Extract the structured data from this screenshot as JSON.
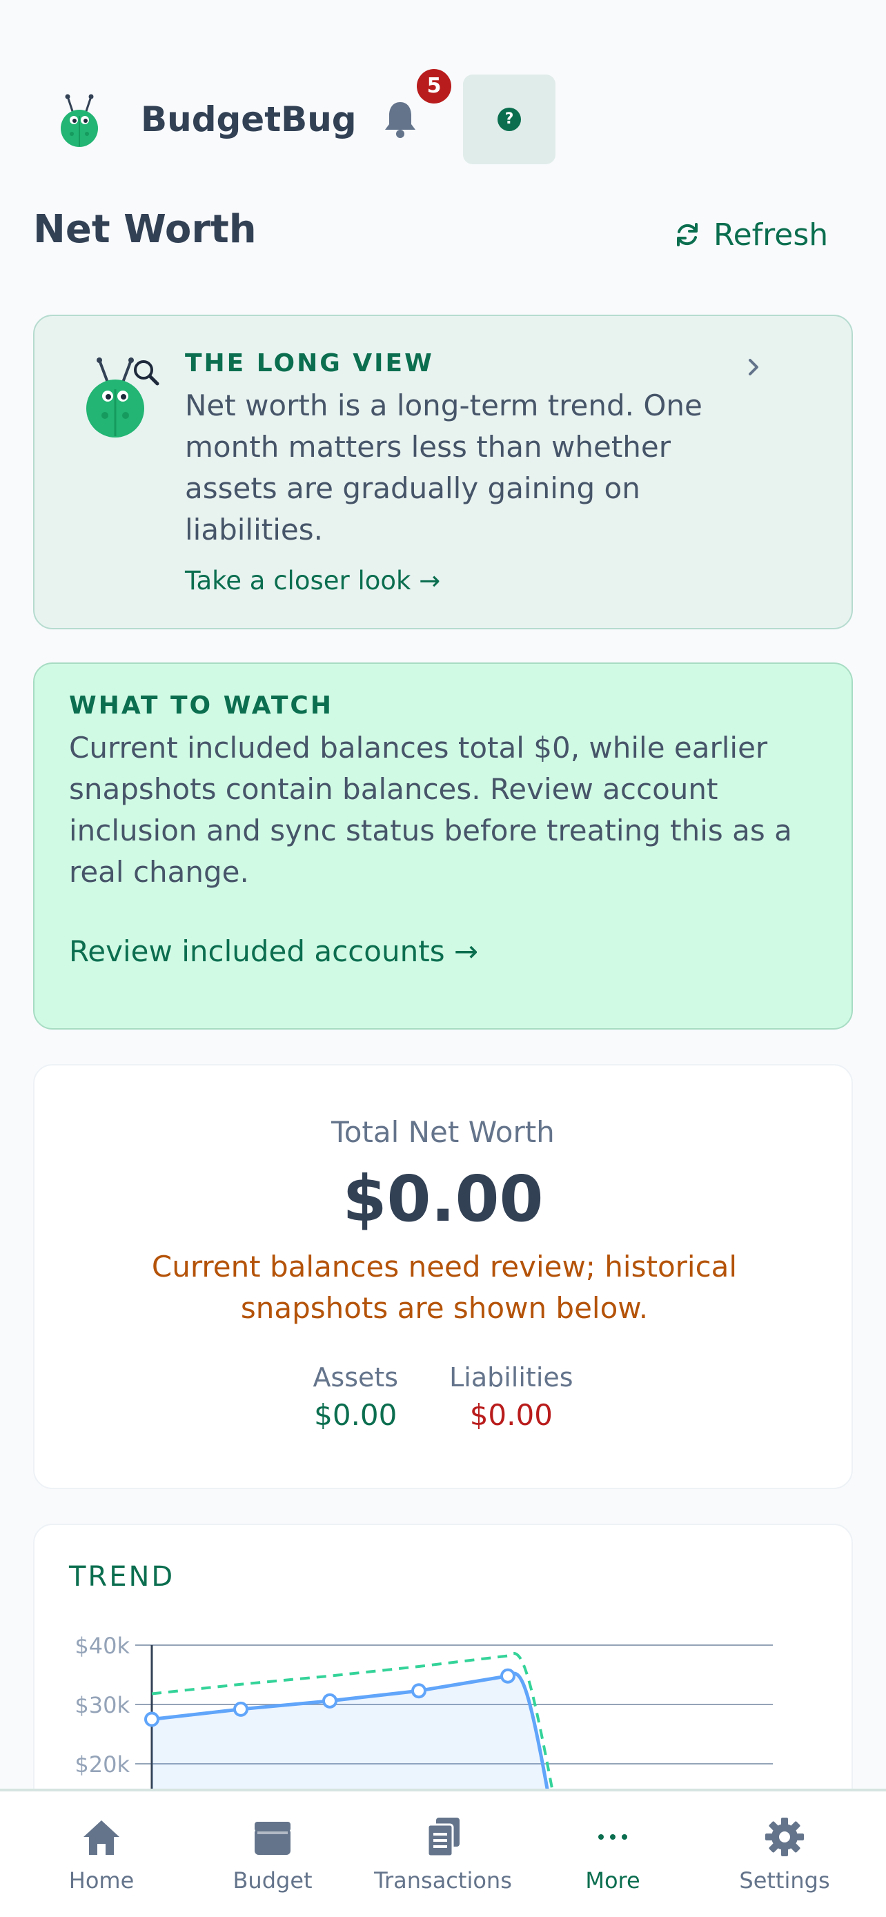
{
  "header": {
    "app_name": "BudgetBug",
    "notification_count": "5",
    "help_glyph": "?"
  },
  "page": {
    "title": "Net Worth",
    "refresh_label": "Refresh"
  },
  "tip_card": {
    "eyebrow": "THE LONG VIEW",
    "body": "Net worth is a long-term trend. One month matters less than whether assets are gradually gaining on liabilities.",
    "link": "Take a closer look →"
  },
  "watch_card": {
    "eyebrow": "WHAT TO WATCH",
    "body": "Current included balances total $0, while earlier snapshots contain balances. Review account inclusion and sync status before treating this as a real change.",
    "link": "Review included accounts →"
  },
  "summary": {
    "label": "Total Net Worth",
    "value": "$0.00",
    "warning": "Current balances need review; historical snapshots are shown below.",
    "assets_label": "Assets",
    "assets_value": "$0.00",
    "liabilities_label": "Liabilities",
    "liabilities_value": "$0.00"
  },
  "trend": {
    "title": "TREND"
  },
  "chart_data": {
    "type": "line",
    "yticks": [
      "$40k",
      "$30k",
      "$20k"
    ],
    "ytick_values": [
      40000,
      30000,
      20000
    ],
    "ylim": [
      20000,
      40000
    ],
    "grid": true,
    "series": [
      {
        "values": [
          27500,
          29200,
          30600,
          32300,
          34800,
          0
        ]
      },
      {
        "values": [
          31800,
          33400,
          34800,
          36400,
          38200,
          0
        ]
      }
    ]
  },
  "tabs": [
    {
      "label": "Home",
      "icon": "home-icon"
    },
    {
      "label": "Budget",
      "icon": "wallet-icon"
    },
    {
      "label": "Transactions",
      "icon": "receipt-icon"
    },
    {
      "label": "More",
      "icon": "more-icon"
    },
    {
      "label": "Settings",
      "icon": "gear-icon"
    }
  ],
  "colors": {
    "brand": "#0b6e4f",
    "warning": "#b45309",
    "danger": "#b91c1c",
    "series_solid": "#60a5fa",
    "series_dashed": "#34d399"
  }
}
